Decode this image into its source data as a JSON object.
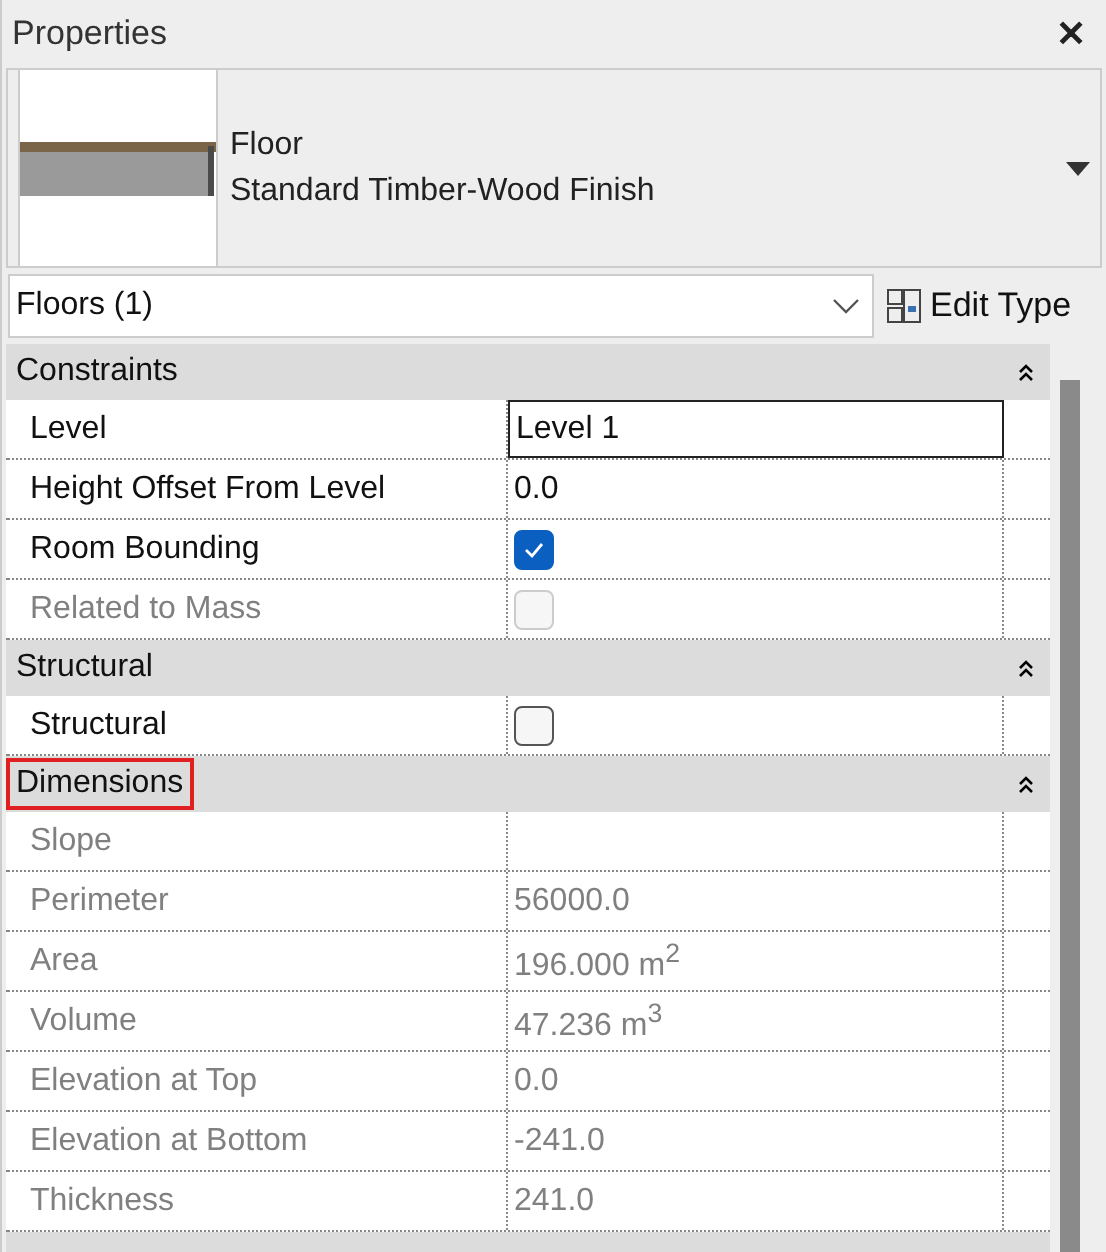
{
  "panel": {
    "title": "Properties",
    "close": "✕"
  },
  "type_selector": {
    "family": "Floor",
    "type": "Standard Timber-Wood Finish"
  },
  "filter": {
    "value": "Floors (1)",
    "edit_type": "Edit Type"
  },
  "sections": [
    {
      "title": "Constraints",
      "highlighted": false,
      "expanded": true,
      "rows": [
        {
          "name": "Level",
          "kind": "text",
          "value": "Level 1",
          "disabled": false,
          "active": true
        },
        {
          "name": "Height Offset From Level",
          "kind": "text",
          "value": "0.0",
          "disabled": false,
          "active": false
        },
        {
          "name": "Room Bounding",
          "kind": "checkbox",
          "checked": true,
          "disabled": false,
          "active": false
        },
        {
          "name": "Related to Mass",
          "kind": "checkbox",
          "checked": false,
          "disabled": true,
          "active": false
        }
      ]
    },
    {
      "title": "Structural",
      "highlighted": false,
      "expanded": true,
      "rows": [
        {
          "name": "Structural",
          "kind": "checkbox",
          "checked": false,
          "disabled": false,
          "active": false
        }
      ]
    },
    {
      "title": "Dimensions",
      "highlighted": true,
      "expanded": true,
      "rows": [
        {
          "name": "Slope",
          "kind": "text",
          "value": "",
          "disabled": true,
          "active": false
        },
        {
          "name": "Perimeter",
          "kind": "text",
          "value": "56000.0",
          "disabled": true,
          "active": false
        },
        {
          "name": "Area",
          "kind": "text",
          "value": "196.000 m$^{2}$",
          "disabled": true,
          "active": false
        },
        {
          "name": "Volume",
          "kind": "text",
          "value": "47.236 m$^{3}$",
          "disabled": true,
          "active": false
        },
        {
          "name": "Elevation at Top",
          "kind": "text",
          "value": "0.0",
          "disabled": true,
          "active": false
        },
        {
          "name": "Elevation at Bottom",
          "kind": "text",
          "value": "-241.0",
          "disabled": true,
          "active": false
        },
        {
          "name": "Thickness",
          "kind": "text",
          "value": "241.0",
          "disabled": true,
          "active": false
        }
      ]
    }
  ]
}
